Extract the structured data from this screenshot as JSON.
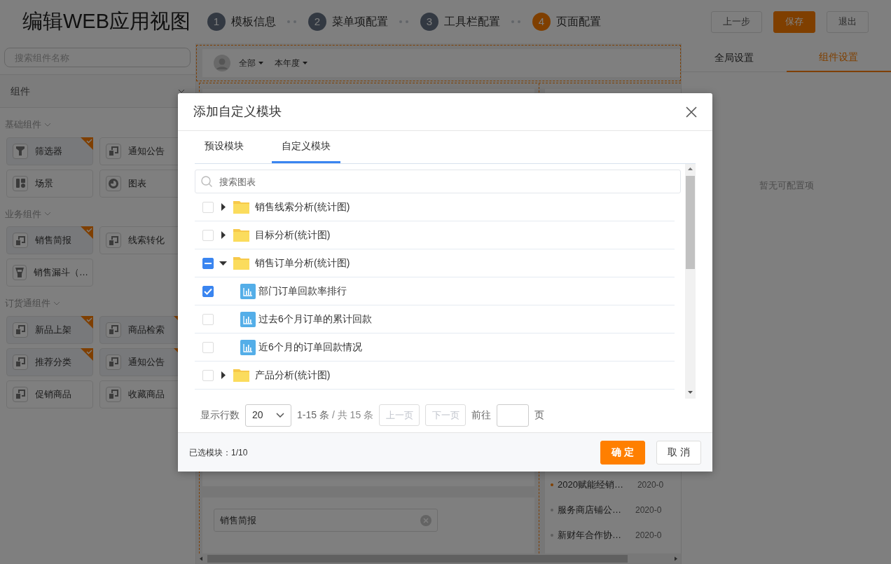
{
  "header": {
    "title": "编辑WEB应用视图",
    "steps": [
      {
        "number": "1",
        "label": "模板信息",
        "selected": false
      },
      {
        "number": "2",
        "label": "菜单项配置",
        "selected": false
      },
      {
        "number": "3",
        "label": "工具栏配置",
        "selected": false
      },
      {
        "number": "4",
        "label": "页面配置",
        "selected": true
      }
    ],
    "buttons": [
      {
        "label": "上一步",
        "kind": "default"
      },
      {
        "label": "保存",
        "kind": "primary"
      },
      {
        "label": "退出",
        "kind": "default"
      }
    ]
  },
  "sidebar": {
    "search": {
      "placeholder": "搜索组件名称"
    },
    "dropdown": "组件",
    "groups": [
      {
        "title": "基础组件",
        "expanded": true,
        "items": [
          {
            "label": "筛选器",
            "kind": "filter",
            "selected": true
          },
          {
            "label": "通知公告",
            "kind": "module",
            "selected": false
          },
          {
            "label": "场景",
            "kind": "scene",
            "selected": false
          },
          {
            "label": "图表",
            "kind": "chart",
            "selected": false
          }
        ]
      },
      {
        "title": "业务组件",
        "expanded": true,
        "items": [
          {
            "label": "销售简报",
            "kind": "module",
            "selected": true
          },
          {
            "label": "线索转化",
            "kind": "module",
            "selected": false
          },
          {
            "label": "销售漏斗（…",
            "kind": "funnel",
            "selected": false
          }
        ]
      },
      {
        "title": "订货通组件",
        "expanded": true,
        "items": [
          {
            "label": "新品上架",
            "kind": "module",
            "selected": true
          },
          {
            "label": "商品检索",
            "kind": "module",
            "selected": true
          },
          {
            "label": "推荐分类",
            "kind": "module",
            "selected": true
          },
          {
            "label": "通知公告",
            "kind": "module",
            "selected": true
          },
          {
            "label": "促销商品",
            "kind": "module",
            "selected": false
          },
          {
            "label": "收藏商品",
            "kind": "module",
            "selected": false
          }
        ]
      }
    ]
  },
  "canvas": {
    "filters": [
      "全部",
      "本年度"
    ],
    "brief_field": {
      "value": "销售简报"
    },
    "news": [
      {
        "title": "2020赋能经销…",
        "date": "2020-0",
        "color": "#804000"
      },
      {
        "title": "服务商店铺公…",
        "date": "2020-0",
        "color": "#5e5e5e"
      },
      {
        "title": "新财年合作协…",
        "date": "2020-0",
        "color": "#5e5e5e"
      }
    ]
  },
  "settings_panel": {
    "tabs": [
      {
        "label": "全局设置",
        "selected": false
      },
      {
        "label": "组件设置",
        "selected": true
      }
    ],
    "empty_text": "暂无可配置项"
  },
  "dialog": {
    "title": "添加自定义模块",
    "tabs": [
      {
        "label": "预设模块",
        "selected": false
      },
      {
        "label": "自定义模块",
        "selected": true
      }
    ],
    "search": {
      "placeholder": "搜索图表"
    },
    "tree": [
      {
        "label": "销售线索分析(统计图)",
        "kind": "folder",
        "checked": false,
        "indeterminate": false,
        "expanded": false
      },
      {
        "label": "目标分析(统计图)",
        "kind": "folder",
        "checked": false,
        "indeterminate": false,
        "expanded": false
      },
      {
        "label": "销售订单分析(统计图)",
        "kind": "folder",
        "checked": false,
        "indeterminate": true,
        "expanded": true,
        "children": [
          {
            "label": "部门订单回款率排行",
            "kind": "chart",
            "checked": true
          },
          {
            "label": "过去6个月订单的累计回款",
            "kind": "chart",
            "checked": false
          },
          {
            "label": "近6个月的订单回款情况",
            "kind": "chart",
            "checked": false
          }
        ]
      },
      {
        "label": "产品分析(统计图)",
        "kind": "folder",
        "checked": false,
        "indeterminate": false,
        "expanded": false
      }
    ],
    "pagination": {
      "label": "显示行数",
      "page_size": "20",
      "range": "1-15 条",
      "total": "/ 共 15 条",
      "prev": {
        "label": "上一页",
        "disabled": true
      },
      "next": {
        "label": "下一页",
        "disabled": true
      },
      "goto_label": "前往",
      "page_suffix": "页"
    },
    "footer": {
      "selected_count": "已选模块：1/10",
      "confirm": "确 定",
      "cancel": "取 消"
    }
  }
}
